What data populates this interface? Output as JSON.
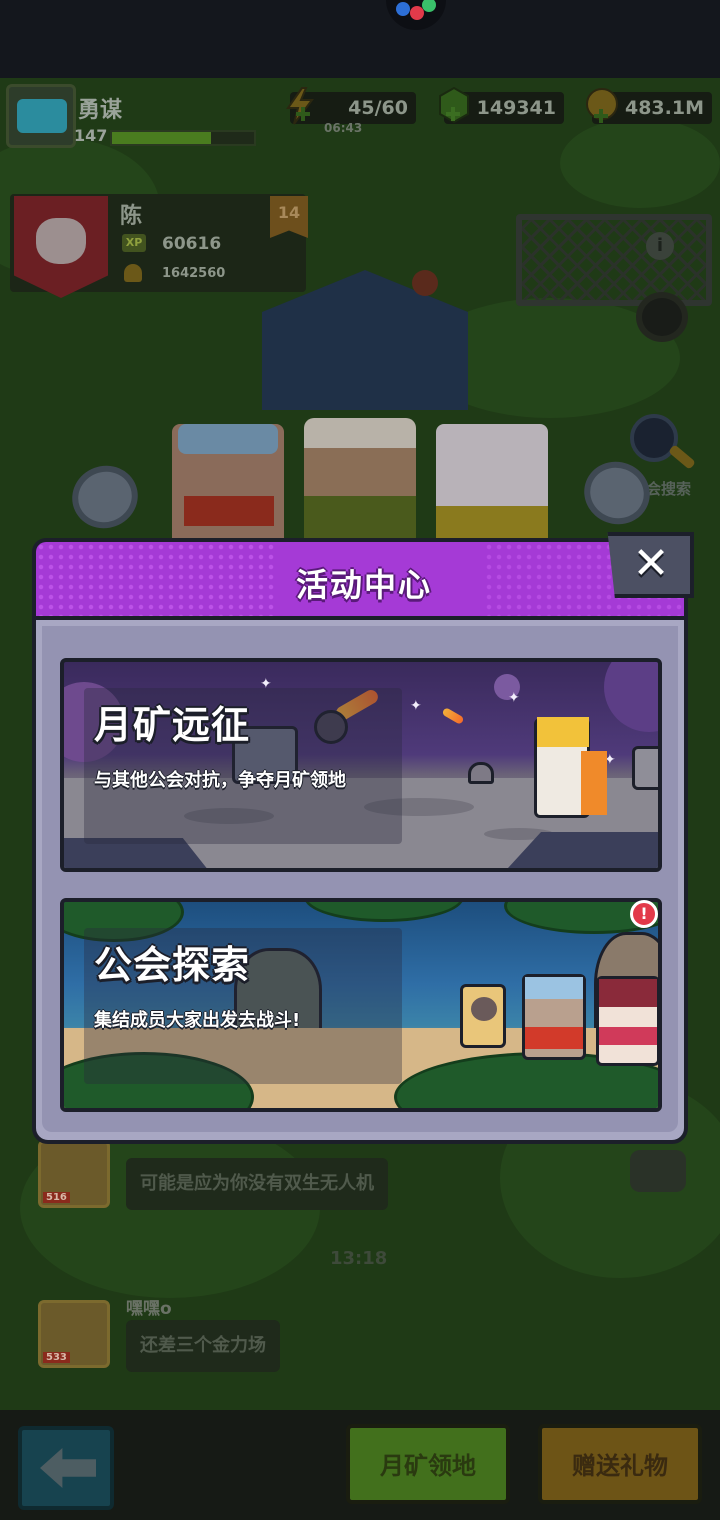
{
  "player": {
    "name": "勇谋",
    "level": "147",
    "xp_fraction": 0.7
  },
  "resources": {
    "energy": "45/60",
    "energy_timer": "06:43",
    "gems": "149341",
    "gold": "483.1M"
  },
  "guild": {
    "name": "陈",
    "level": "14",
    "xp_label": "XP",
    "xp": "60616",
    "trophies": "1642560"
  },
  "map_labels": {
    "guild_explore_partial": "会搜索"
  },
  "modal": {
    "title": "活动中心",
    "close_label": "✕",
    "events": [
      {
        "title": "月矿远征",
        "description": "与其他公会对抗，争夺月矿领地",
        "has_alert": false
      },
      {
        "title": "公会探索",
        "description": "集结成员大家出发去战斗!",
        "has_alert": true,
        "alert_label": "!"
      }
    ]
  },
  "chat": {
    "messages": [
      {
        "avatar_level": "516",
        "text": "可能是应为你没有双生无人机"
      },
      {
        "time": "13:18"
      },
      {
        "user": "嘿嘿o",
        "avatar_level": "533",
        "text": "还差三个金力场"
      }
    ]
  },
  "bottom_bar": {
    "back_label": "back",
    "button_moon_territory": "月矿领地",
    "button_send_gift": "赠送礼物"
  },
  "colors": {
    "modal_header": "#a53ad6",
    "modal_body": "#a8a7c3",
    "close_button": "#4c5063",
    "alert": "#e23a4a"
  },
  "icons": {
    "energy": "lightning-icon",
    "gems": "gem-icon",
    "gold": "coin-icon",
    "close": "close-icon",
    "back": "arrow-left-icon",
    "info": "info-icon",
    "search": "magnifier-icon",
    "chat": "chat-icon"
  }
}
